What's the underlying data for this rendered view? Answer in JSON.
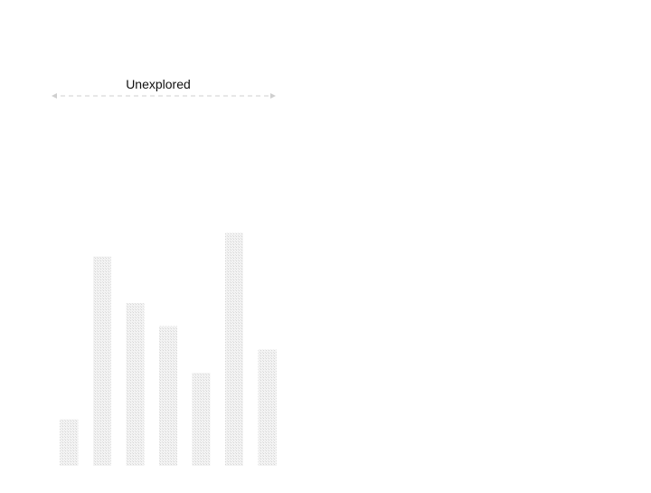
{
  "chart_data": {
    "type": "bar",
    "categories": [
      "",
      "",
      "",
      "",
      "",
      "",
      ""
    ],
    "values": [
      10,
      45,
      35,
      30,
      20,
      50,
      25
    ],
    "ylim": [
      0,
      55
    ],
    "title": "",
    "xlabel": "",
    "ylabel": "",
    "grid": false,
    "annotations": [
      {
        "text": "Unexplored",
        "type": "span-arrow",
        "x_from": 0,
        "x_to": 7
      }
    ],
    "colors": {
      "bar_fill": "#d9d9d9",
      "bar_texture": "#e9e9e9",
      "annotation_line": "#cfcfcf",
      "annotation_text": "#111111"
    }
  }
}
